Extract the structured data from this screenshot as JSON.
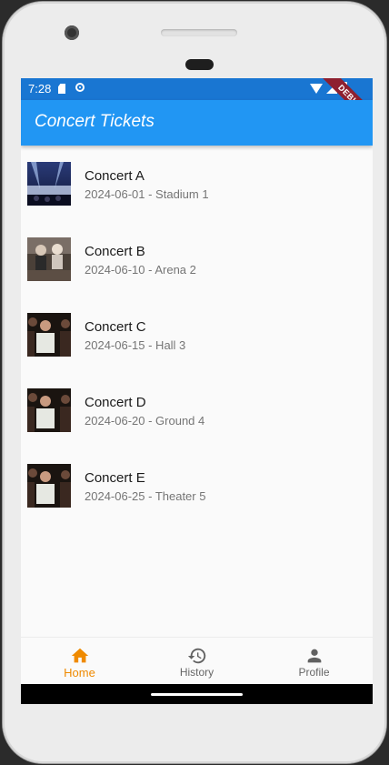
{
  "status_bar": {
    "time": "7:28",
    "icons": [
      "sd-card-icon",
      "gear-icon",
      "wifi-icon",
      "signal-icon",
      "battery-icon"
    ]
  },
  "debug_banner": "DEBUG",
  "app_bar": {
    "title": "Concert Tickets",
    "color": "#2196f3"
  },
  "concerts": [
    {
      "name": "Concert A",
      "details": "2024-06-01 - Stadium 1"
    },
    {
      "name": "Concert B",
      "details": "2024-06-10 - Arena 2"
    },
    {
      "name": "Concert C",
      "details": "2024-06-15 - Hall 3"
    },
    {
      "name": "Concert D",
      "details": "2024-06-20 - Ground 4"
    },
    {
      "name": "Concert E",
      "details": "2024-06-25 - Theater 5"
    }
  ],
  "bottom_nav": {
    "active_color": "#ef8a00",
    "items": [
      {
        "label": "Home",
        "icon": "home-icon",
        "active": true
      },
      {
        "label": "History",
        "icon": "history-icon",
        "active": false
      },
      {
        "label": "Profile",
        "icon": "person-icon",
        "active": false
      }
    ]
  }
}
